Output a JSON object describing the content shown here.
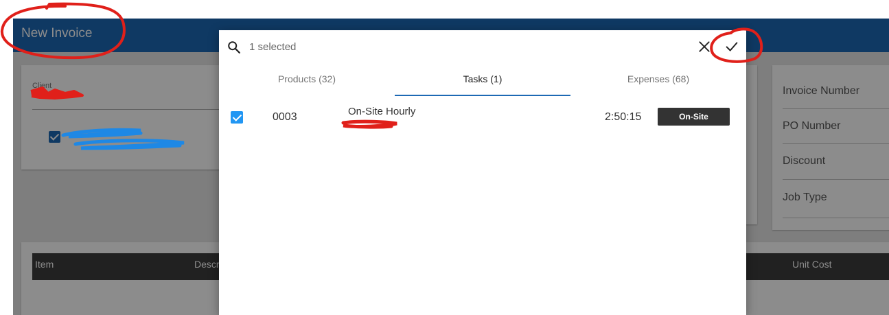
{
  "app": {
    "title": "New Invoice",
    "client": {
      "label": "Client",
      "value": ""
    },
    "fields": [
      "Invoice Number",
      "PO Number",
      "Discount",
      "Job Type"
    ],
    "item_columns": [
      "Item",
      "Descr",
      "Unit Cost"
    ]
  },
  "dialog": {
    "search": {
      "placeholder": "1 selected"
    },
    "tabs": [
      {
        "label": "Products (32)",
        "active": false
      },
      {
        "label": "Tasks (1)",
        "active": true
      },
      {
        "label": "Expenses (68)",
        "active": false
      }
    ],
    "rows": [
      {
        "checked": true,
        "number": "0003",
        "description": "On-Site Hourly",
        "subtitle": "",
        "duration": "2:50:15",
        "badge": "On-Site"
      }
    ]
  },
  "colors": {
    "primary": "#1d69b4",
    "checkbox": "#2196f3",
    "badge": "#333333",
    "annotation_red": "#e0201a",
    "annotation_blue": "#1e88e5"
  }
}
